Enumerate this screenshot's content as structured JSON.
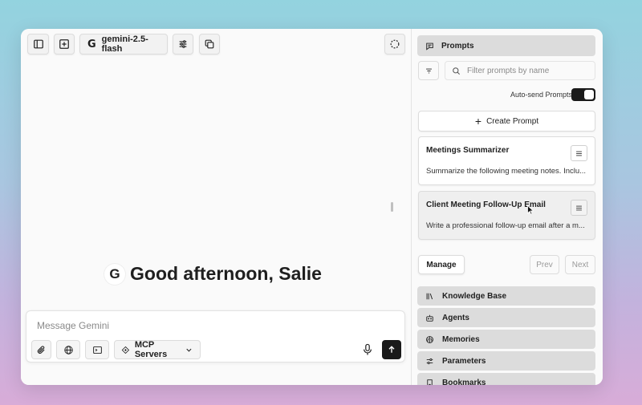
{
  "toolbar": {
    "model_label": "gemini-2.5-flash",
    "model_icon": "G"
  },
  "chat": {
    "greeting": "Good afternoon, Salie",
    "greeting_icon": "G"
  },
  "composer": {
    "placeholder": "Message Gemini",
    "mcp_label": "MCP Servers"
  },
  "sidebar": {
    "prompts_title": "Prompts",
    "filter_placeholder": "Filter prompts by name",
    "autosend_label": "Auto-send Prompts",
    "autosend_on": true,
    "create_label": "Create Prompt",
    "prompts": [
      {
        "title": "Meetings Summarizer",
        "desc": "Summarize the following meeting notes. Inclu..."
      },
      {
        "title": "Client Meeting Follow-Up Email",
        "desc": "Write a professional follow-up email after a m..."
      }
    ],
    "manage_label": "Manage",
    "prev_label": "Prev",
    "next_label": "Next",
    "sections": [
      {
        "label": "Knowledge Base",
        "icon": "library-icon"
      },
      {
        "label": "Agents",
        "icon": "bot-icon"
      },
      {
        "label": "Memories",
        "icon": "brain-icon"
      },
      {
        "label": "Parameters",
        "icon": "sliders-icon"
      },
      {
        "label": "Bookmarks",
        "icon": "bookmark-icon"
      }
    ]
  }
}
